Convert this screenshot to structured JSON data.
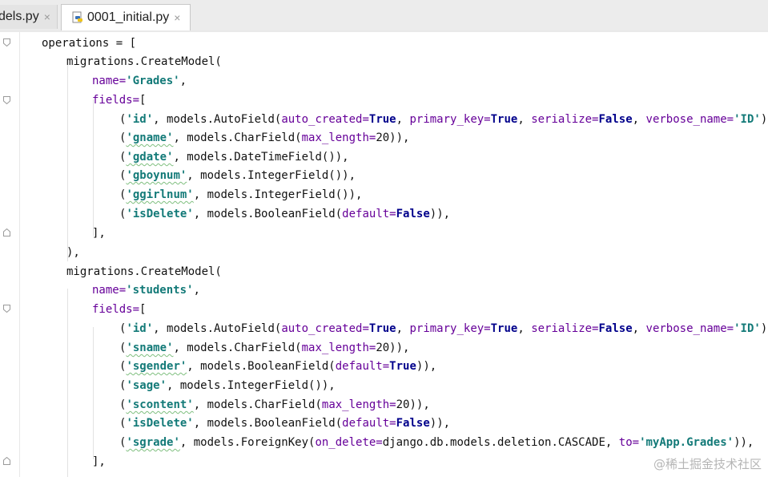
{
  "tabs": [
    {
      "label": "dels.py",
      "close": "×",
      "active": false
    },
    {
      "label": "0001_initial.py",
      "close": "×",
      "active": true
    }
  ],
  "code": {
    "operations": "operations = [",
    "create_model": "migrations.CreateModel(",
    "models": [
      {
        "name_key": "name=",
        "name_value": "'Grades'",
        "fields_open": "fields=[",
        "fields": [
          [
            "('id', models.AutoField(",
            "auto_created=",
            "True",
            ", ",
            "primary_key=",
            "True",
            ", ",
            "serialize=",
            "False",
            ", ",
            "verbose_name=",
            "'ID'",
            ")),"
          ]
        ]
      }
    ]
  },
  "lines": [
    "operations = [",
    "migrations.CreateModel(",
    "name='Grades',",
    "fields=[",
    "('id', models.AutoField(auto_created=True, primary_key=True, serialize=False, verbose_name='ID')),",
    "('gname', models.CharField(max_length=20)),",
    "('gdate', models.DateTimeField()),",
    "('gboynum', models.IntegerField()),",
    "('ggirlnum', models.IntegerField()),",
    "('isDelete', models.BooleanField(default=False)),",
    "],",
    "),",
    "migrations.CreateModel(",
    "name='students',",
    "fields=[",
    "('id', models.AutoField(auto_created=True, primary_key=True, serialize=False, verbose_name='ID')),",
    "('sname', models.CharField(max_length=20)),",
    "('sgender', models.BooleanField(default=True)),",
    "('sage', models.IntegerField()),",
    "('scontent', models.CharField(max_length=20)),",
    "('isDelete', models.BooleanField(default=False)),",
    "('sgrade', models.ForeignKey(on_delete=django.db.models.deletion.CASCADE, to='myApp.Grades')),",
    "],"
  ],
  "watermark": "@稀土掘金技术社区",
  "colors": {
    "keyword": "#00008b",
    "string": "#137a78",
    "param": "#660099"
  }
}
